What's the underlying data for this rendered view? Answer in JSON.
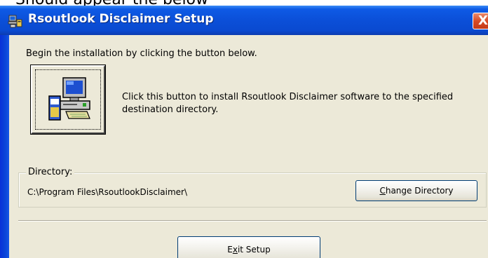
{
  "top_fragment": {
    "text": "Should appear the below"
  },
  "window": {
    "title": "Rsoutlook Disclaimer Setup",
    "close_glyph": "X",
    "icon": "setup-computer-icon"
  },
  "content": {
    "begin_text": "Begin the installation by clicking the button below.",
    "install_description": "Click this button to install Rsoutlook Disclaimer software to the specified destination directory.",
    "install_icon": "computer-install-icon"
  },
  "directory": {
    "legend": "Directory:",
    "path": "C:\\Program Files\\RsoutlookDisclaimer\\",
    "change_button": {
      "underline_char": "C",
      "rest": "hange Directory"
    }
  },
  "exit_button": {
    "before": "E",
    "underline_char": "x",
    "after": "it Setup"
  },
  "colors": {
    "titlebar": "#0b4fd8",
    "client_bg": "#ece9d8",
    "close_button": "#d84b26"
  }
}
